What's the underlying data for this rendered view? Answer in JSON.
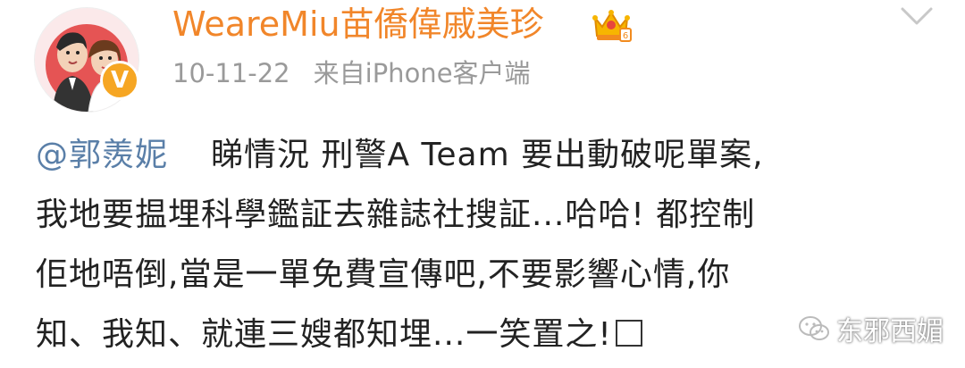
{
  "post": {
    "username": "WeareMiu苗僑偉戚美珍",
    "timestamp": "10-11-22",
    "source": "来自iPhone客户端",
    "verify_badge": "V",
    "mention": "@郭羨妮",
    "lines": [
      "睇情況 刑警A Team 要出動破呢單案,",
      "我地要揾埋科學鑑証去雜誌社搜証...哈哈! 都控制",
      "佢地唔倒,當是一單免費宣傳吧,不要影響心情,你",
      "知、我知、就連三嫂都知埋...一笑置之!"
    ]
  },
  "watermark": {
    "text": "东邪西媚"
  },
  "colors": {
    "username": "#f1862a",
    "mention": "#5a7fa8",
    "meta": "#9a9a9a",
    "badge": "#f6a623"
  },
  "icons": [
    "avatar-photo",
    "verified-v-icon",
    "vip-crown-icon",
    "chevron-down-icon",
    "wechat-logo-icon"
  ]
}
